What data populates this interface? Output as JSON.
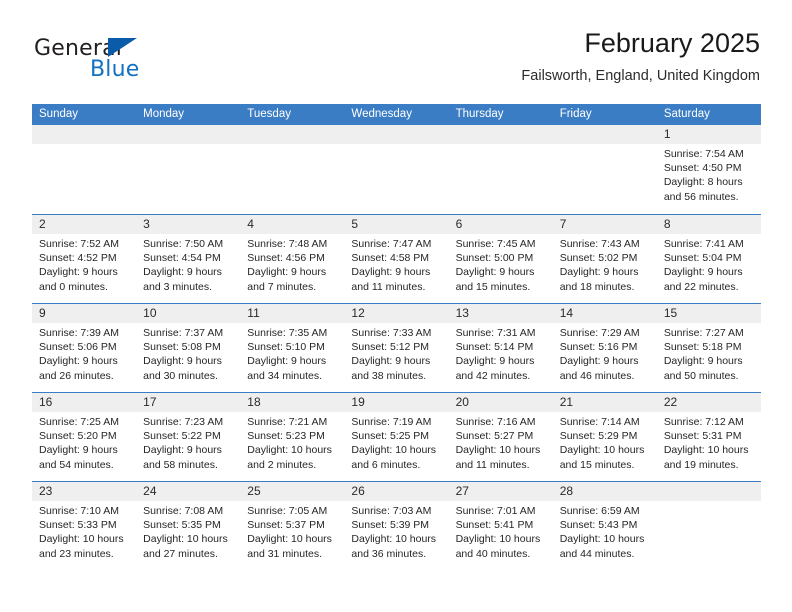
{
  "brand": {
    "name_part1": "General",
    "name_part2": "Blue",
    "triangle_color": "#0b5ca8",
    "blue_color": "#1271c0"
  },
  "header": {
    "title": "February 2025",
    "subtitle": "Failsworth, England, United Kingdom"
  },
  "theme": {
    "header_blue": "#3b7dc4",
    "day_band_gray": "#efefef",
    "text_color": "#262626"
  },
  "weekdays": [
    {
      "label": "Sunday"
    },
    {
      "label": "Monday"
    },
    {
      "label": "Tuesday"
    },
    {
      "label": "Wednesday"
    },
    {
      "label": "Thursday"
    },
    {
      "label": "Friday"
    },
    {
      "label": "Saturday"
    }
  ],
  "weeks": [
    [
      {
        "day": "",
        "sunrise": "",
        "sunset": "",
        "daylight_line1": "",
        "daylight_line2": ""
      },
      {
        "day": "",
        "sunrise": "",
        "sunset": "",
        "daylight_line1": "",
        "daylight_line2": ""
      },
      {
        "day": "",
        "sunrise": "",
        "sunset": "",
        "daylight_line1": "",
        "daylight_line2": ""
      },
      {
        "day": "",
        "sunrise": "",
        "sunset": "",
        "daylight_line1": "",
        "daylight_line2": ""
      },
      {
        "day": "",
        "sunrise": "",
        "sunset": "",
        "daylight_line1": "",
        "daylight_line2": ""
      },
      {
        "day": "",
        "sunrise": "",
        "sunset": "",
        "daylight_line1": "",
        "daylight_line2": ""
      },
      {
        "day": "1",
        "sunrise": "Sunrise: 7:54 AM",
        "sunset": "Sunset: 4:50 PM",
        "daylight_line1": "Daylight: 8 hours",
        "daylight_line2": "and 56 minutes."
      }
    ],
    [
      {
        "day": "2",
        "sunrise": "Sunrise: 7:52 AM",
        "sunset": "Sunset: 4:52 PM",
        "daylight_line1": "Daylight: 9 hours",
        "daylight_line2": "and 0 minutes."
      },
      {
        "day": "3",
        "sunrise": "Sunrise: 7:50 AM",
        "sunset": "Sunset: 4:54 PM",
        "daylight_line1": "Daylight: 9 hours",
        "daylight_line2": "and 3 minutes."
      },
      {
        "day": "4",
        "sunrise": "Sunrise: 7:48 AM",
        "sunset": "Sunset: 4:56 PM",
        "daylight_line1": "Daylight: 9 hours",
        "daylight_line2": "and 7 minutes."
      },
      {
        "day": "5",
        "sunrise": "Sunrise: 7:47 AM",
        "sunset": "Sunset: 4:58 PM",
        "daylight_line1": "Daylight: 9 hours",
        "daylight_line2": "and 11 minutes."
      },
      {
        "day": "6",
        "sunrise": "Sunrise: 7:45 AM",
        "sunset": "Sunset: 5:00 PM",
        "daylight_line1": "Daylight: 9 hours",
        "daylight_line2": "and 15 minutes."
      },
      {
        "day": "7",
        "sunrise": "Sunrise: 7:43 AM",
        "sunset": "Sunset: 5:02 PM",
        "daylight_line1": "Daylight: 9 hours",
        "daylight_line2": "and 18 minutes."
      },
      {
        "day": "8",
        "sunrise": "Sunrise: 7:41 AM",
        "sunset": "Sunset: 5:04 PM",
        "daylight_line1": "Daylight: 9 hours",
        "daylight_line2": "and 22 minutes."
      }
    ],
    [
      {
        "day": "9",
        "sunrise": "Sunrise: 7:39 AM",
        "sunset": "Sunset: 5:06 PM",
        "daylight_line1": "Daylight: 9 hours",
        "daylight_line2": "and 26 minutes."
      },
      {
        "day": "10",
        "sunrise": "Sunrise: 7:37 AM",
        "sunset": "Sunset: 5:08 PM",
        "daylight_line1": "Daylight: 9 hours",
        "daylight_line2": "and 30 minutes."
      },
      {
        "day": "11",
        "sunrise": "Sunrise: 7:35 AM",
        "sunset": "Sunset: 5:10 PM",
        "daylight_line1": "Daylight: 9 hours",
        "daylight_line2": "and 34 minutes."
      },
      {
        "day": "12",
        "sunrise": "Sunrise: 7:33 AM",
        "sunset": "Sunset: 5:12 PM",
        "daylight_line1": "Daylight: 9 hours",
        "daylight_line2": "and 38 minutes."
      },
      {
        "day": "13",
        "sunrise": "Sunrise: 7:31 AM",
        "sunset": "Sunset: 5:14 PM",
        "daylight_line1": "Daylight: 9 hours",
        "daylight_line2": "and 42 minutes."
      },
      {
        "day": "14",
        "sunrise": "Sunrise: 7:29 AM",
        "sunset": "Sunset: 5:16 PM",
        "daylight_line1": "Daylight: 9 hours",
        "daylight_line2": "and 46 minutes."
      },
      {
        "day": "15",
        "sunrise": "Sunrise: 7:27 AM",
        "sunset": "Sunset: 5:18 PM",
        "daylight_line1": "Daylight: 9 hours",
        "daylight_line2": "and 50 minutes."
      }
    ],
    [
      {
        "day": "16",
        "sunrise": "Sunrise: 7:25 AM",
        "sunset": "Sunset: 5:20 PM",
        "daylight_line1": "Daylight: 9 hours",
        "daylight_line2": "and 54 minutes."
      },
      {
        "day": "17",
        "sunrise": "Sunrise: 7:23 AM",
        "sunset": "Sunset: 5:22 PM",
        "daylight_line1": "Daylight: 9 hours",
        "daylight_line2": "and 58 minutes."
      },
      {
        "day": "18",
        "sunrise": "Sunrise: 7:21 AM",
        "sunset": "Sunset: 5:23 PM",
        "daylight_line1": "Daylight: 10 hours",
        "daylight_line2": "and 2 minutes."
      },
      {
        "day": "19",
        "sunrise": "Sunrise: 7:19 AM",
        "sunset": "Sunset: 5:25 PM",
        "daylight_line1": "Daylight: 10 hours",
        "daylight_line2": "and 6 minutes."
      },
      {
        "day": "20",
        "sunrise": "Sunrise: 7:16 AM",
        "sunset": "Sunset: 5:27 PM",
        "daylight_line1": "Daylight: 10 hours",
        "daylight_line2": "and 11 minutes."
      },
      {
        "day": "21",
        "sunrise": "Sunrise: 7:14 AM",
        "sunset": "Sunset: 5:29 PM",
        "daylight_line1": "Daylight: 10 hours",
        "daylight_line2": "and 15 minutes."
      },
      {
        "day": "22",
        "sunrise": "Sunrise: 7:12 AM",
        "sunset": "Sunset: 5:31 PM",
        "daylight_line1": "Daylight: 10 hours",
        "daylight_line2": "and 19 minutes."
      }
    ],
    [
      {
        "day": "23",
        "sunrise": "Sunrise: 7:10 AM",
        "sunset": "Sunset: 5:33 PM",
        "daylight_line1": "Daylight: 10 hours",
        "daylight_line2": "and 23 minutes."
      },
      {
        "day": "24",
        "sunrise": "Sunrise: 7:08 AM",
        "sunset": "Sunset: 5:35 PM",
        "daylight_line1": "Daylight: 10 hours",
        "daylight_line2": "and 27 minutes."
      },
      {
        "day": "25",
        "sunrise": "Sunrise: 7:05 AM",
        "sunset": "Sunset: 5:37 PM",
        "daylight_line1": "Daylight: 10 hours",
        "daylight_line2": "and 31 minutes."
      },
      {
        "day": "26",
        "sunrise": "Sunrise: 7:03 AM",
        "sunset": "Sunset: 5:39 PM",
        "daylight_line1": "Daylight: 10 hours",
        "daylight_line2": "and 36 minutes."
      },
      {
        "day": "27",
        "sunrise": "Sunrise: 7:01 AM",
        "sunset": "Sunset: 5:41 PM",
        "daylight_line1": "Daylight: 10 hours",
        "daylight_line2": "and 40 minutes."
      },
      {
        "day": "28",
        "sunrise": "Sunrise: 6:59 AM",
        "sunset": "Sunset: 5:43 PM",
        "daylight_line1": "Daylight: 10 hours",
        "daylight_line2": "and 44 minutes."
      },
      {
        "day": "",
        "sunrise": "",
        "sunset": "",
        "daylight_line1": "",
        "daylight_line2": ""
      }
    ]
  ]
}
